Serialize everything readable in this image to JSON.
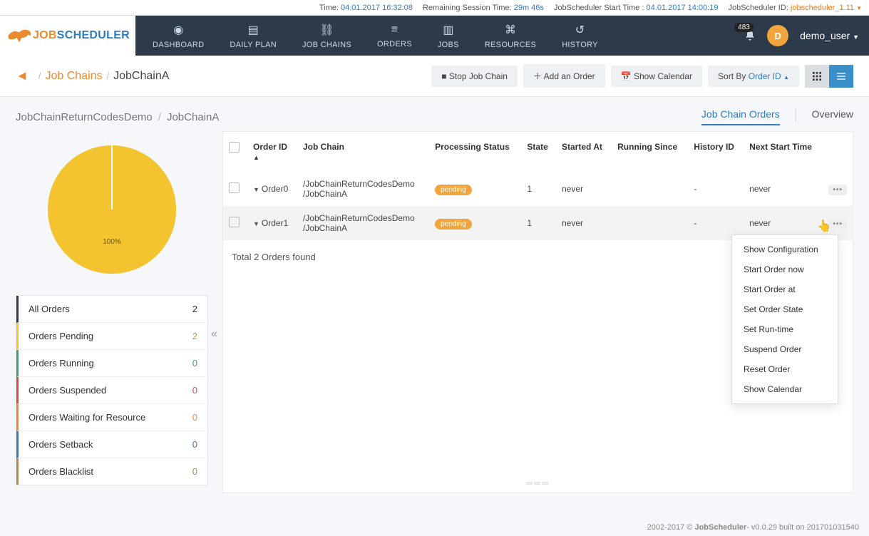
{
  "topbar": {
    "time_lbl": "Time:",
    "time_val": "04.01.2017 16:32:08",
    "session_lbl": "Remaining Session Time:",
    "session_val": "29m 46s",
    "start_lbl": "JobScheduler Start Time :",
    "start_val": "04.01.2017 14:00:19",
    "id_lbl": "JobScheduler ID:",
    "id_val": "jobscheduler_1.11"
  },
  "nav": {
    "items": [
      {
        "icon": "dashboard-icon",
        "label": "DASHBOARD"
      },
      {
        "icon": "daily-plan-icon",
        "label": "DAILY PLAN"
      },
      {
        "icon": "job-chains-icon",
        "label": "JOB CHAINS"
      },
      {
        "icon": "orders-icon",
        "label": "ORDERS"
      },
      {
        "icon": "jobs-icon",
        "label": "JOBS"
      },
      {
        "icon": "resources-icon",
        "label": "RESOURCES"
      },
      {
        "icon": "history-icon",
        "label": "HISTORY"
      }
    ],
    "notif_count": "483",
    "avatar_letter": "D",
    "username": "demo_user"
  },
  "breadcrumb": {
    "link": "Job Chains",
    "current": "JobChainA",
    "actions": {
      "stop": "Stop Job Chain",
      "add": "Add an Order",
      "calendar": "Show Calendar",
      "sort_prefix": "Sort By ",
      "sort_field": "Order ID"
    }
  },
  "sub_breadcrumb": {
    "root": "JobChainReturnCodesDemo",
    "leaf": "JobChainA"
  },
  "tabs": {
    "orders": "Job Chain Orders",
    "overview": "Overview"
  },
  "chart_data": {
    "type": "pie",
    "title": "",
    "slices": [
      {
        "label": "Orders Pending",
        "value": 2,
        "pct": "100%",
        "color": "#f4c430"
      }
    ]
  },
  "filters": [
    {
      "label": "All Orders",
      "count": "2",
      "color": "#2d3a4a",
      "count_color": "#333"
    },
    {
      "label": "Orders Pending",
      "count": "2",
      "color": "#f4c430",
      "count_color": "#e98b2e"
    },
    {
      "label": "Orders Running",
      "count": "0",
      "color": "#3ba272",
      "count_color": "#3ba272"
    },
    {
      "label": "Orders Suspended",
      "count": "0",
      "color": "#d94b3b",
      "count_color": "#d94b3b"
    },
    {
      "label": "Orders Waiting for Resource",
      "count": "0",
      "color": "#e98b2e",
      "count_color": "#e98b2e"
    },
    {
      "label": "Orders Setback",
      "count": "0",
      "color": "#307cc3",
      "count_color": "#307cc3"
    },
    {
      "label": "Orders Blacklist",
      "count": "0",
      "color": "#b88a3a",
      "count_color": "#b88a3a"
    }
  ],
  "table": {
    "headers": {
      "order_id": "Order ID",
      "job_chain": "Job Chain",
      "status": "Processing Status",
      "state": "State",
      "started": "Started At",
      "running": "Running Since",
      "history": "History ID",
      "next": "Next Start Time"
    },
    "rows": [
      {
        "order_id": "Order0",
        "job_chain": "/JobChainReturnCodesDemo/JobChainA",
        "status": "pending",
        "state": "1",
        "started": "never",
        "running": "",
        "history": "-",
        "next": "never"
      },
      {
        "order_id": "Order1",
        "job_chain": "/JobChainReturnCodesDemo/JobChainA",
        "status": "pending",
        "state": "1",
        "started": "never",
        "running": "",
        "history": "-",
        "next": "never"
      }
    ],
    "total": "Total 2 Orders found"
  },
  "context_menu": [
    "Show Configuration",
    "Start Order now",
    "Start Order at",
    "Set Order State",
    "Set Run-time",
    "Suspend Order",
    "Reset Order",
    "Show Calendar"
  ],
  "footer": {
    "copyright": "2002-2017 © ",
    "brand": "JobScheduler",
    "version": "- v0.0.29 built on 201701031540"
  }
}
